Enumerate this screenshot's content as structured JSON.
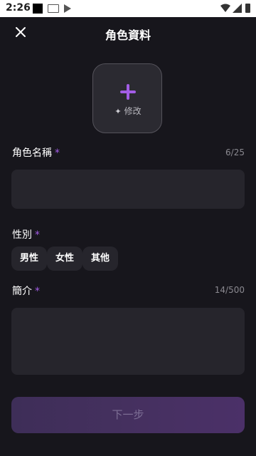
{
  "status_bar": {
    "time": "2:26"
  },
  "header": {
    "title": "角色資料",
    "close_icon": "close-icon"
  },
  "avatar": {
    "edit_label": "修改",
    "plus_icon": "plus-icon",
    "sparkle_icon": "sparkle-icon"
  },
  "name_field": {
    "label": "角色名稱",
    "required_mark": "*",
    "counter": "6/25",
    "value": ""
  },
  "gender": {
    "label": "性別",
    "required_mark": "*",
    "options": [
      "男性",
      "女性",
      "其他"
    ]
  },
  "intro_field": {
    "label": "簡介",
    "required_mark": "*",
    "counter": "14/500",
    "value": ""
  },
  "next_button": {
    "label": "下一步"
  },
  "colors": {
    "accent": "#a35de6",
    "background": "#17161c",
    "field": "#26252c"
  }
}
